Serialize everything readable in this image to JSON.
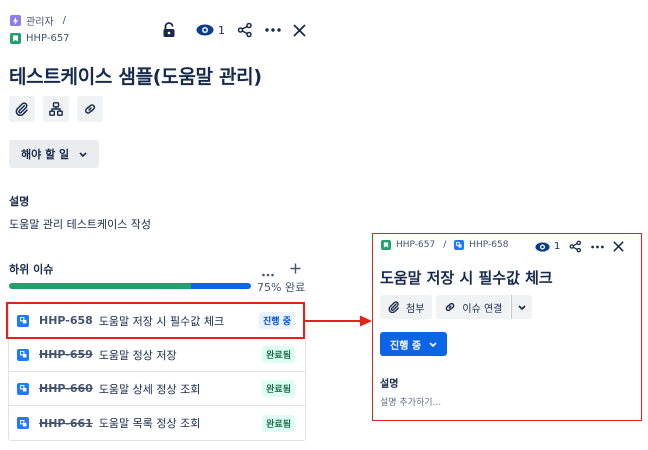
{
  "breadcrumb": {
    "project": "관리자",
    "separator": "/",
    "issue_key": "HHP-657"
  },
  "header": {
    "watch_count": "1"
  },
  "issue": {
    "title": "테스트케이스 샘플(도움말 관리)",
    "status": "해야 할 일"
  },
  "description": {
    "label": "설명",
    "text": "도움말 관리 테스트케이스 작성"
  },
  "child_issues": {
    "label": "하위 이슈",
    "progress_text": "75% 완료",
    "progress_done": 0.75,
    "items": [
      {
        "key": "HHP-658",
        "summary": "도움말 저장 시 필수값 체크",
        "status": "진행 중",
        "done": false
      },
      {
        "key": "HHP-659",
        "summary": "도움말 정상 저장",
        "status": "완료됨",
        "done": true
      },
      {
        "key": "HHP-660",
        "summary": "도움말 상세 정상 조회",
        "status": "완료됨",
        "done": true
      },
      {
        "key": "HHP-661",
        "summary": "도움말 목록 정상 조회",
        "status": "완료됨",
        "done": true
      }
    ]
  },
  "detail_panel": {
    "parent_key": "HHP-657",
    "separator": "/",
    "key": "HHP-658",
    "watch_count": "1",
    "title": "도움말 저장 시 필수값 체크",
    "attach_label": "첨부",
    "link_label": "이슈 연결",
    "status": "진행 중",
    "desc_label": "설명",
    "desc_placeholder": "설명 추가하기..."
  },
  "colors": {
    "highlight": "#e2231a",
    "primary": "#0c66e4",
    "success": "#22a06b"
  }
}
